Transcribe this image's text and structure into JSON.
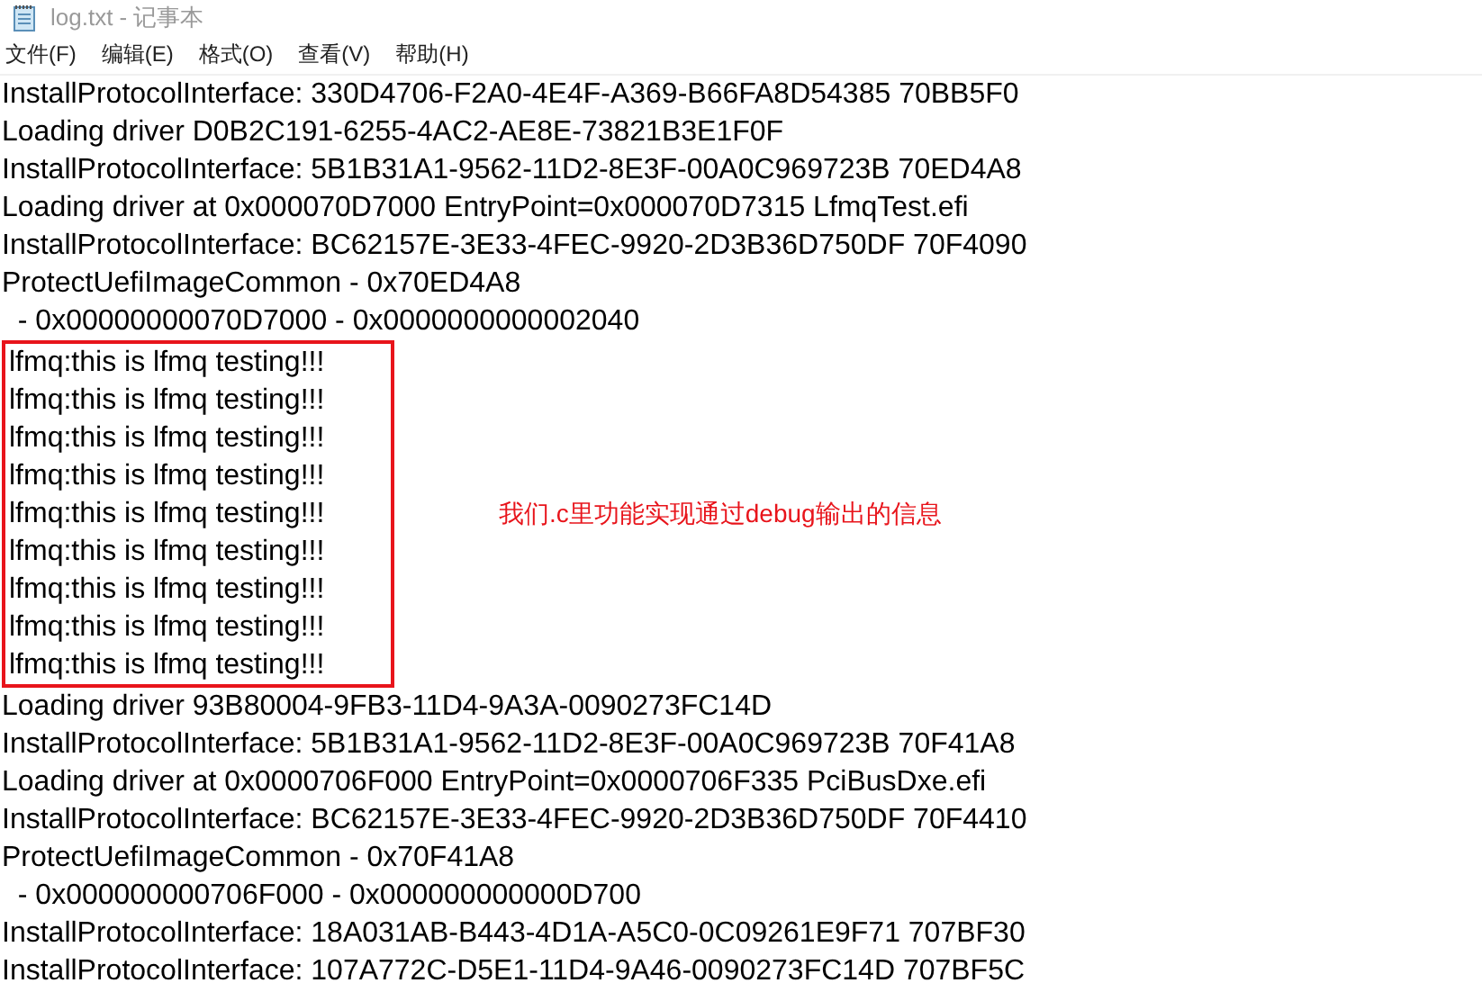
{
  "window": {
    "title": "log.txt - 记事本"
  },
  "menu": [
    "文件(F)",
    "编辑(E)",
    "格式(O)",
    "查看(V)",
    "帮助(H)"
  ],
  "lines_before": [
    "InstallProtocolInterface: 330D4706-F2A0-4E4F-A369-B66FA8D54385 70BB5F0",
    "Loading driver D0B2C191-6255-4AC2-AE8E-73821B3E1F0F",
    "InstallProtocolInterface: 5B1B31A1-9562-11D2-8E3F-00A0C969723B 70ED4A8",
    "Loading driver at 0x000070D7000 EntryPoint=0x000070D7315 LfmqTest.efi",
    "InstallProtocolInterface: BC62157E-3E33-4FEC-9920-2D3B36D750DF 70F4090",
    "ProtectUefiImageCommon - 0x70ED4A8",
    "  - 0x00000000070D7000 - 0x0000000000002040"
  ],
  "highlight": {
    "lines": [
      "lfmq:this is lfmq testing!!!",
      "lfmq:this is lfmq testing!!!",
      "lfmq:this is lfmq testing!!!",
      "lfmq:this is lfmq testing!!!",
      "lfmq:this is lfmq testing!!!",
      "lfmq:this is lfmq testing!!!",
      "lfmq:this is lfmq testing!!!",
      "lfmq:this is lfmq testing!!!",
      "lfmq:this is lfmq testing!!!"
    ],
    "note": "我们.c里功能实现通过debug输出的信息"
  },
  "lines_after": [
    "Loading driver 93B80004-9FB3-11D4-9A3A-0090273FC14D",
    "InstallProtocolInterface: 5B1B31A1-9562-11D2-8E3F-00A0C969723B 70F41A8",
    "Loading driver at 0x0000706F000 EntryPoint=0x0000706F335 PciBusDxe.efi",
    "InstallProtocolInterface: BC62157E-3E33-4FEC-9920-2D3B36D750DF 70F4410",
    "ProtectUefiImageCommon - 0x70F41A8",
    "  - 0x000000000706F000 - 0x000000000000D700",
    "InstallProtocolInterface: 18A031AB-B443-4D1A-A5C0-0C09261E9F71 707BF30",
    "InstallProtocolInterface: 107A772C-D5E1-11D4-9A46-0090273FC14D 707BF5C"
  ]
}
